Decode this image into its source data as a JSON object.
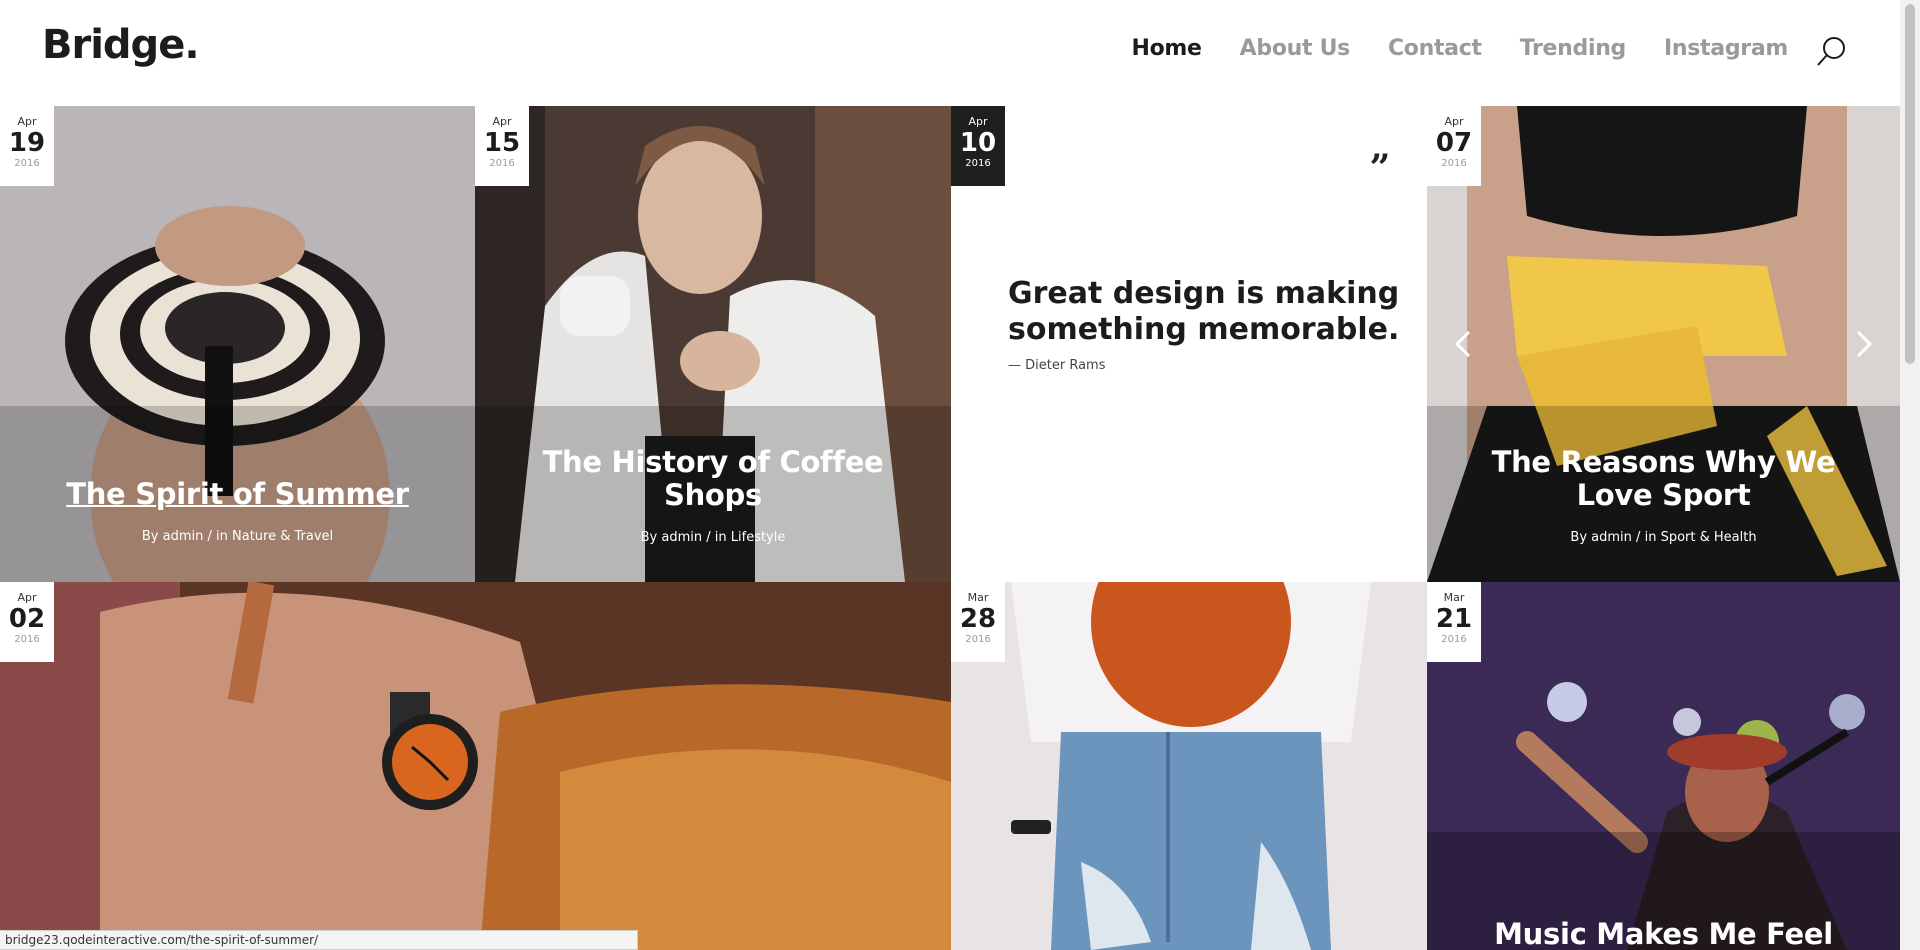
{
  "header": {
    "logo": "Bridge.",
    "nav": [
      {
        "label": "Home",
        "active": true
      },
      {
        "label": "About Us",
        "active": false
      },
      {
        "label": "Contact",
        "active": false
      },
      {
        "label": "Trending",
        "active": false
      },
      {
        "label": "Instagram",
        "active": false
      }
    ],
    "search_icon": "search-icon"
  },
  "posts": [
    {
      "month": "Apr",
      "day": "19",
      "year": "2016",
      "title": "The Spirit of Summer",
      "by": "By",
      "author": "admin",
      "sep": "/",
      "in": "in",
      "category": "Nature & Travel"
    },
    {
      "month": "Apr",
      "day": "15",
      "year": "2016",
      "title": "The History of Coffee Shops",
      "by": "By",
      "author": "admin",
      "sep": "/",
      "in": "in",
      "category": "Lifestyle"
    },
    {
      "month": "Apr",
      "day": "10",
      "year": "2016",
      "quote": "Great design is making something memorable.",
      "quote_author": "— Dieter Rams",
      "quote_mark": "„"
    },
    {
      "month": "Apr",
      "day": "07",
      "year": "2016",
      "title": "The Reasons Why We Love Sport",
      "by": "By",
      "author": "admin",
      "sep": "/",
      "in": "in",
      "category": "Sport & Health"
    },
    {
      "month": "Apr",
      "day": "02",
      "year": "2016"
    },
    {
      "month": "Mar",
      "day": "28",
      "year": "2016"
    },
    {
      "month": "Mar",
      "day": "21",
      "year": "2016",
      "title": "Music Makes Me Feel"
    }
  ],
  "statusbar": "bridge23.qodeinteractive.com/the-spirit-of-summer/",
  "colors": {
    "dark": "#1c1c1c",
    "muted": "#9a9a9a",
    "badge_dark": "#1f1f1f"
  }
}
